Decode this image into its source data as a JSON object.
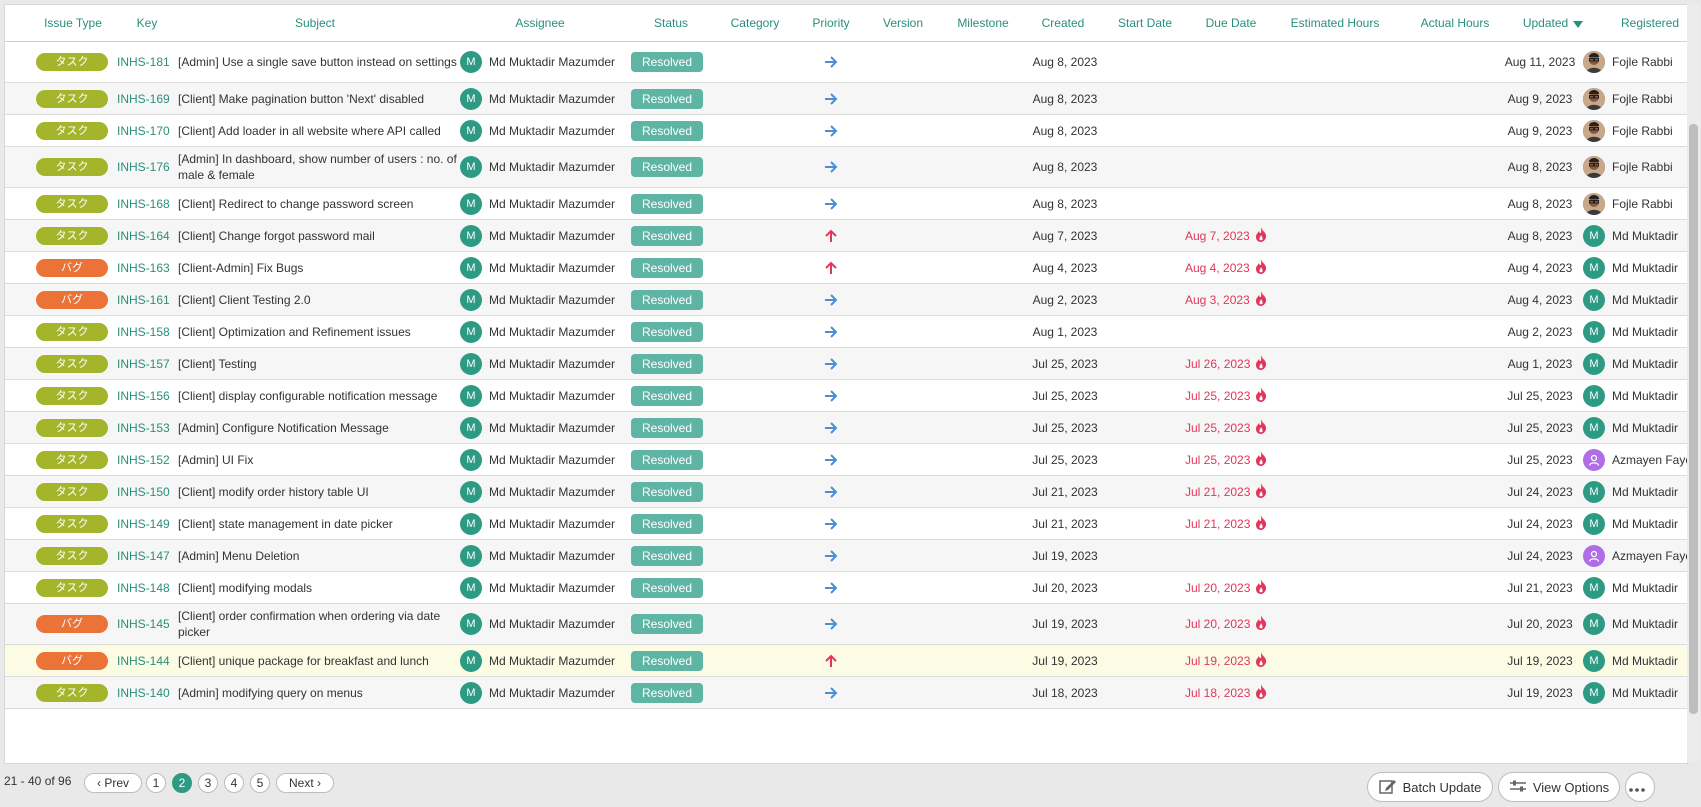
{
  "columns": {
    "issue_type": "Issue Type",
    "key": "Key",
    "subject": "Subject",
    "assignee": "Assignee",
    "status": "Status",
    "category": "Category",
    "priority": "Priority",
    "version": "Version",
    "milestone": "Milestone",
    "created": "Created",
    "start_date": "Start Date",
    "due_date": "Due Date",
    "estimated_hours": "Estimated Hours",
    "actual_hours": "Actual Hours",
    "updated": "Updated",
    "registered": "Registered"
  },
  "colors": {
    "accent": "#2a8f7b",
    "task": "#a4b52c",
    "bug": "#ec7338",
    "status_resolved": "#5fb5a4",
    "overdue": "#e2375a",
    "priority_normal": "#4a8fd6",
    "priority_high": "#e2375a"
  },
  "rows": [
    {
      "type": "タスク",
      "type_kind": "task",
      "key": "INHS-181",
      "subject": "[Admin] Use a single save button instead on settings",
      "assignee": "Md Muktadir Mazumder",
      "assignee_initial": "M",
      "status": "Resolved",
      "priority": "normal",
      "created": "Aug 8, 2023",
      "due": "",
      "updated": "Aug 11, 2023",
      "registered": "Fojle Rabbi",
      "reg_avatar": "photo",
      "reg_initial": "",
      "tall": true,
      "highlight": false
    },
    {
      "type": "タスク",
      "type_kind": "task",
      "key": "INHS-169",
      "subject": "[Client] Make pagination button 'Next' disabled",
      "assignee": "Md Muktadir Mazumder",
      "assignee_initial": "M",
      "status": "Resolved",
      "priority": "normal",
      "created": "Aug 8, 2023",
      "due": "",
      "updated": "Aug 9, 2023",
      "registered": "Fojle Rabbi",
      "reg_avatar": "photo",
      "reg_initial": "",
      "tall": false,
      "highlight": false
    },
    {
      "type": "タスク",
      "type_kind": "task",
      "key": "INHS-170",
      "subject": "[Client] Add loader in all website where API called",
      "assignee": "Md Muktadir Mazumder",
      "assignee_initial": "M",
      "status": "Resolved",
      "priority": "normal",
      "created": "Aug 8, 2023",
      "due": "",
      "updated": "Aug 9, 2023",
      "registered": "Fojle Rabbi",
      "reg_avatar": "photo",
      "reg_initial": "",
      "tall": false,
      "highlight": false
    },
    {
      "type": "タスク",
      "type_kind": "task",
      "key": "INHS-176",
      "subject": "[Admin] In dashboard, show number of users : no. of male & female",
      "assignee": "Md Muktadir Mazumder",
      "assignee_initial": "M",
      "status": "Resolved",
      "priority": "normal",
      "created": "Aug 8, 2023",
      "due": "",
      "updated": "Aug 8, 2023",
      "registered": "Fojle Rabbi",
      "reg_avatar": "photo",
      "reg_initial": "",
      "tall": true,
      "highlight": false
    },
    {
      "type": "タスク",
      "type_kind": "task",
      "key": "INHS-168",
      "subject": "[Client] Redirect to change password screen",
      "assignee": "Md Muktadir Mazumder",
      "assignee_initial": "M",
      "status": "Resolved",
      "priority": "normal",
      "created": "Aug 8, 2023",
      "due": "",
      "updated": "Aug 8, 2023",
      "registered": "Fojle Rabbi",
      "reg_avatar": "photo",
      "reg_initial": "",
      "tall": false,
      "highlight": false
    },
    {
      "type": "タスク",
      "type_kind": "task",
      "key": "INHS-164",
      "subject": "[Client] Change forgot password mail",
      "assignee": "Md Muktadir Mazumder",
      "assignee_initial": "M",
      "status": "Resolved",
      "priority": "high",
      "created": "Aug 7, 2023",
      "due": "Aug 7, 2023",
      "updated": "Aug 8, 2023",
      "registered": "Md Muktadir",
      "reg_avatar": "initial",
      "reg_initial": "M",
      "tall": false,
      "highlight": false
    },
    {
      "type": "バグ",
      "type_kind": "bug",
      "key": "INHS-163",
      "subject": "[Client-Admin] Fix Bugs",
      "assignee": "Md Muktadir Mazumder",
      "assignee_initial": "M",
      "status": "Resolved",
      "priority": "high",
      "created": "Aug 4, 2023",
      "due": "Aug 4, 2023",
      "updated": "Aug 4, 2023",
      "registered": "Md Muktadir",
      "reg_avatar": "initial",
      "reg_initial": "M",
      "tall": false,
      "highlight": false
    },
    {
      "type": "バグ",
      "type_kind": "bug",
      "key": "INHS-161",
      "subject": "[Client] Client Testing 2.0",
      "assignee": "Md Muktadir Mazumder",
      "assignee_initial": "M",
      "status": "Resolved",
      "priority": "normal",
      "created": "Aug 2, 2023",
      "due": "Aug 3, 2023",
      "updated": "Aug 4, 2023",
      "registered": "Md Muktadir",
      "reg_avatar": "initial",
      "reg_initial": "M",
      "tall": false,
      "highlight": false
    },
    {
      "type": "タスク",
      "type_kind": "task",
      "key": "INHS-158",
      "subject": "[Client] Optimization and Refinement issues",
      "assignee": "Md Muktadir Mazumder",
      "assignee_initial": "M",
      "status": "Resolved",
      "priority": "normal",
      "created": "Aug 1, 2023",
      "due": "",
      "updated": "Aug 2, 2023",
      "registered": "Md Muktadir",
      "reg_avatar": "initial",
      "reg_initial": "M",
      "tall": false,
      "highlight": false
    },
    {
      "type": "タスク",
      "type_kind": "task",
      "key": "INHS-157",
      "subject": "[Client] Testing",
      "assignee": "Md Muktadir Mazumder",
      "assignee_initial": "M",
      "status": "Resolved",
      "priority": "normal",
      "created": "Jul 25, 2023",
      "due": "Jul 26, 2023",
      "updated": "Aug 1, 2023",
      "registered": "Md Muktadir",
      "reg_avatar": "initial",
      "reg_initial": "M",
      "tall": false,
      "highlight": false
    },
    {
      "type": "タスク",
      "type_kind": "task",
      "key": "INHS-156",
      "subject": "[Client] display configurable notification message",
      "assignee": "Md Muktadir Mazumder",
      "assignee_initial": "M",
      "status": "Resolved",
      "priority": "normal",
      "created": "Jul 25, 2023",
      "due": "Jul 25, 2023",
      "updated": "Jul 25, 2023",
      "registered": "Md Muktadir",
      "reg_avatar": "initial",
      "reg_initial": "M",
      "tall": false,
      "highlight": false
    },
    {
      "type": "タスク",
      "type_kind": "task",
      "key": "INHS-153",
      "subject": "[Admin] Configure Notification Message",
      "assignee": "Md Muktadir Mazumder",
      "assignee_initial": "M",
      "status": "Resolved",
      "priority": "normal",
      "created": "Jul 25, 2023",
      "due": "Jul 25, 2023",
      "updated": "Jul 25, 2023",
      "registered": "Md Muktadir",
      "reg_avatar": "initial",
      "reg_initial": "M",
      "tall": false,
      "highlight": false
    },
    {
      "type": "タスク",
      "type_kind": "task",
      "key": "INHS-152",
      "subject": "[Admin] UI Fix",
      "assignee": "Md Muktadir Mazumder",
      "assignee_initial": "M",
      "status": "Resolved",
      "priority": "normal",
      "created": "Jul 25, 2023",
      "due": "Jul 25, 2023",
      "updated": "Jul 25, 2023",
      "registered": "Azmayen Faye",
      "reg_avatar": "purple",
      "reg_initial": "",
      "tall": false,
      "highlight": false
    },
    {
      "type": "タスク",
      "type_kind": "task",
      "key": "INHS-150",
      "subject": "[Client] modify order history table UI",
      "assignee": "Md Muktadir Mazumder",
      "assignee_initial": "M",
      "status": "Resolved",
      "priority": "normal",
      "created": "Jul 21, 2023",
      "due": "Jul 21, 2023",
      "updated": "Jul 24, 2023",
      "registered": "Md Muktadir",
      "reg_avatar": "initial",
      "reg_initial": "M",
      "tall": false,
      "highlight": false
    },
    {
      "type": "タスク",
      "type_kind": "task",
      "key": "INHS-149",
      "subject": "[Client] state management in date picker",
      "assignee": "Md Muktadir Mazumder",
      "assignee_initial": "M",
      "status": "Resolved",
      "priority": "normal",
      "created": "Jul 21, 2023",
      "due": "Jul 21, 2023",
      "updated": "Jul 24, 2023",
      "registered": "Md Muktadir",
      "reg_avatar": "initial",
      "reg_initial": "M",
      "tall": false,
      "highlight": false
    },
    {
      "type": "タスク",
      "type_kind": "task",
      "key": "INHS-147",
      "subject": "[Admin] Menu Deletion",
      "assignee": "Md Muktadir Mazumder",
      "assignee_initial": "M",
      "status": "Resolved",
      "priority": "normal",
      "created": "Jul 19, 2023",
      "due": "",
      "updated": "Jul 24, 2023",
      "registered": "Azmayen Faye",
      "reg_avatar": "purple",
      "reg_initial": "",
      "tall": false,
      "highlight": false
    },
    {
      "type": "タスク",
      "type_kind": "task",
      "key": "INHS-148",
      "subject": "[Client] modifying modals",
      "assignee": "Md Muktadir Mazumder",
      "assignee_initial": "M",
      "status": "Resolved",
      "priority": "normal",
      "created": "Jul 20, 2023",
      "due": "Jul 20, 2023",
      "updated": "Jul 21, 2023",
      "registered": "Md Muktadir",
      "reg_avatar": "initial",
      "reg_initial": "M",
      "tall": false,
      "highlight": false
    },
    {
      "type": "バグ",
      "type_kind": "bug",
      "key": "INHS-145",
      "subject": "[Client] order confirmation when ordering via date picker",
      "assignee": "Md Muktadir Mazumder",
      "assignee_initial": "M",
      "status": "Resolved",
      "priority": "normal",
      "created": "Jul 19, 2023",
      "due": "Jul 20, 2023",
      "updated": "Jul 20, 2023",
      "registered": "Md Muktadir",
      "reg_avatar": "initial",
      "reg_initial": "M",
      "tall": true,
      "highlight": false
    },
    {
      "type": "バグ",
      "type_kind": "bug",
      "key": "INHS-144",
      "subject": "[Client] unique package for breakfast and lunch",
      "assignee": "Md Muktadir Mazumder",
      "assignee_initial": "M",
      "status": "Resolved",
      "priority": "high",
      "created": "Jul 19, 2023",
      "due": "Jul 19, 2023",
      "updated": "Jul 19, 2023",
      "registered": "Md Muktadir",
      "reg_avatar": "initial",
      "reg_initial": "M",
      "tall": false,
      "highlight": true
    },
    {
      "type": "タスク",
      "type_kind": "task",
      "key": "INHS-140",
      "subject": "[Admin] modifying query on menus",
      "assignee": "Md Muktadir Mazumder",
      "assignee_initial": "M",
      "status": "Resolved",
      "priority": "normal",
      "created": "Jul 18, 2023",
      "due": "Jul 18, 2023",
      "updated": "Jul 19, 2023",
      "registered": "Md Muktadir",
      "reg_avatar": "initial",
      "reg_initial": "M",
      "tall": false,
      "highlight": false
    }
  ],
  "pagination": {
    "range_text": "21 - 40 of 96",
    "prev_label": "Prev",
    "next_label": "Next",
    "pages": [
      "1",
      "2",
      "3",
      "4",
      "5"
    ],
    "current_page": "2"
  },
  "actions": {
    "batch_update": "Batch Update",
    "view_options": "View Options"
  }
}
